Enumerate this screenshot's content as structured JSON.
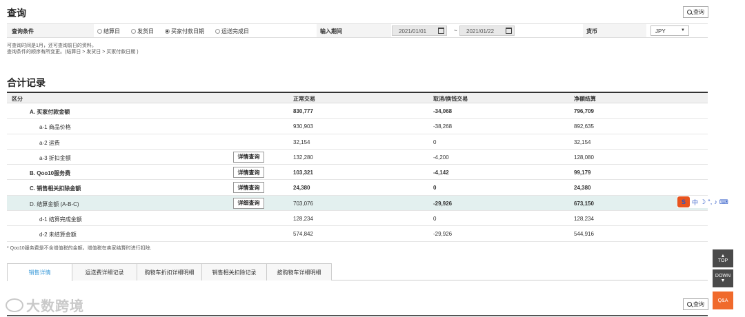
{
  "page": {
    "title": "查询",
    "search_label": "查询",
    "search_label_bottom": "查询"
  },
  "conditions": {
    "label": "查询条件",
    "options": [
      {
        "label": "结算日",
        "selected": false
      },
      {
        "label": "发货日",
        "selected": false
      },
      {
        "label": "买家付款日期",
        "selected": true
      },
      {
        "label": "运送完成日",
        "selected": false
      }
    ],
    "period_label": "输入期间",
    "date_from": "2021/01/01",
    "date_to": "2021/01/22",
    "tilde": "~",
    "currency_label": "货币",
    "currency_value": "JPY",
    "notes": [
      "可查询时间是1月，还可查询前日的资料。",
      "查询条件的顺序有所变更。(结算日 > 发货日 > 买家付款日期 )"
    ]
  },
  "summary": {
    "title": "合计记录",
    "headers": {
      "category": "区分",
      "normal": "正常交易",
      "cancel": "取消/换钱交易",
      "net": "净额结算"
    },
    "detail_label": "详情查询",
    "detail_label_d": "详细查询",
    "rows": [
      {
        "label": "A. 买家付款金额",
        "normal": "830,777",
        "cancel": "-34,068",
        "net": "796,709"
      },
      {
        "label": "a-1 商品价格",
        "normal": "930,903",
        "cancel": "-38,268",
        "net": "892,635"
      },
      {
        "label": "a-2 运费",
        "normal": "32,154",
        "cancel": "0",
        "net": "32,154"
      },
      {
        "label": "a-3 折扣金额",
        "normal": "132,280",
        "cancel": "-4,200",
        "net": "128,080"
      },
      {
        "label": "B. Qoo10服务费",
        "normal": "103,321",
        "cancel": "-4,142",
        "net": "99,179"
      },
      {
        "label": "C. 销售相关扣除金额",
        "normal": "24,380",
        "cancel": "0",
        "net": "24,380"
      },
      {
        "label": "D. 结算金额 (A-B-C)",
        "normal": "703,076",
        "cancel": "-29,926",
        "net": "673,150"
      },
      {
        "label": "d-1 结算完成金额",
        "normal": "128,234",
        "cancel": "0",
        "net": "128,234"
      },
      {
        "label": "d-2 未结算金额",
        "normal": "574,842",
        "cancel": "-29,926",
        "net": "544,916"
      }
    ],
    "footnote": "* Qoo10服务费是不含增值税的金额，增值税在卖家结算时进行扣除."
  },
  "tabs": [
    {
      "label": "销售详情",
      "active": true
    },
    {
      "label": "运送费详细记录",
      "active": false
    },
    {
      "label": "购物车折扣详细明细",
      "active": false
    },
    {
      "label": "销售相关扣除记录",
      "active": false
    },
    {
      "label": "按购物车详细明细",
      "active": false
    }
  ],
  "watermark": "大数跨境",
  "float": {
    "top": "TOP",
    "down": "DOWN",
    "qa": "Q&A"
  },
  "ime": {
    "logo": "S",
    "lang": "中"
  },
  "colors": {
    "highlight_row": "#e3f0ef",
    "active_tab": "#3a9ad9",
    "qa_button": "#f06a2c",
    "ime_logo": "#e8541e"
  }
}
